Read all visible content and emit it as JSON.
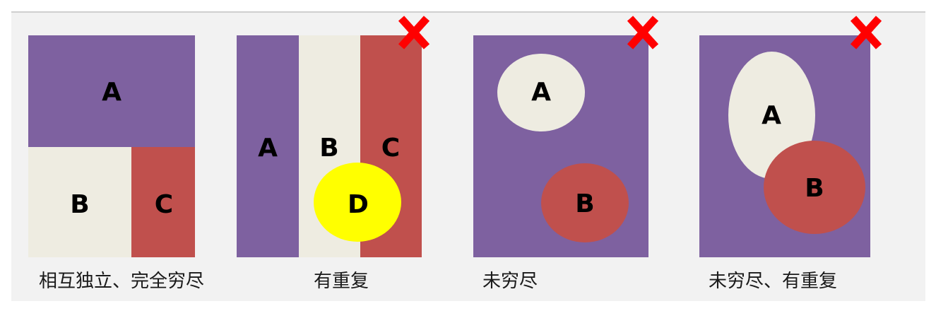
{
  "colors": {
    "purple": "#7e61a0",
    "cream": "#eeece1",
    "red": "#c0504d",
    "yellow": "#ffff00",
    "x_mark": "#ff0000"
  },
  "icons": {
    "wrong_mark": "x-mark-icon"
  },
  "panels": [
    {
      "labels": {
        "a": "A",
        "b": "B",
        "c": "C"
      },
      "caption": "相互独立、完全穷尽"
    },
    {
      "labels": {
        "a": "A",
        "b": "B",
        "c": "C",
        "d": "D"
      },
      "caption": "有重复"
    },
    {
      "labels": {
        "a": "A",
        "b": "B"
      },
      "caption": "未穷尽"
    },
    {
      "labels": {
        "a": "A",
        "b": "B"
      },
      "caption": "未穷尽、有重复"
    }
  ]
}
